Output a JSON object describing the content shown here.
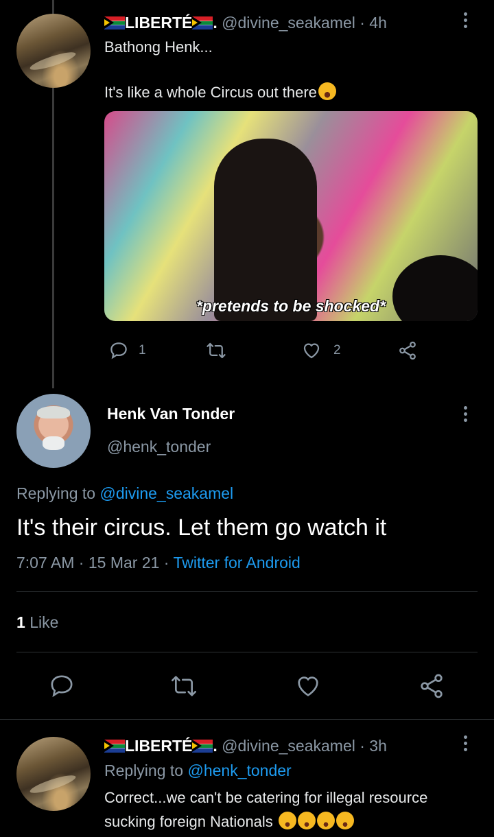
{
  "tweet1": {
    "display_name": "LIBERTÉ",
    "display_suffix": ".",
    "handle": "@divine_seakamel",
    "time": "4h",
    "text_line1": "Bathong Henk...",
    "text_line2": "It's like a whole Circus out there",
    "media_caption": "*pretends to be shocked*",
    "reply_count": "1",
    "retweet_count": "",
    "like_count": "2"
  },
  "main_tweet": {
    "display_name": "Henk Van Tonder",
    "handle": "@henk_tonder",
    "replying_prefix": "Replying to ",
    "replying_to": "@divine_seakamel",
    "text": "It's their circus. Let them go watch it",
    "time": "7:07 AM",
    "date": "15 Mar 21",
    "source": "Twitter for Android",
    "likes_count": "1",
    "likes_label": "Like"
  },
  "reply": {
    "display_name": "LIBERTÉ",
    "display_suffix": ".",
    "handle": "@divine_seakamel",
    "time": "3h",
    "replying_prefix": "Replying to ",
    "replying_to": "@henk_tonder",
    "text_line1": "Correct...we can't be catering for illegal resource",
    "text_line2": "sucking foreign Nationals"
  },
  "separator": "·",
  "icons": {
    "reply": "speech-bubble-icon",
    "retweet": "retweet-icon",
    "like": "heart-icon",
    "share": "share-icon",
    "more": "more-vertical-icon",
    "flag": "south-africa-flag-icon"
  },
  "colors": {
    "accent": "#1d9bf0",
    "secondary_text": "#8b98a5",
    "background": "#000000"
  }
}
